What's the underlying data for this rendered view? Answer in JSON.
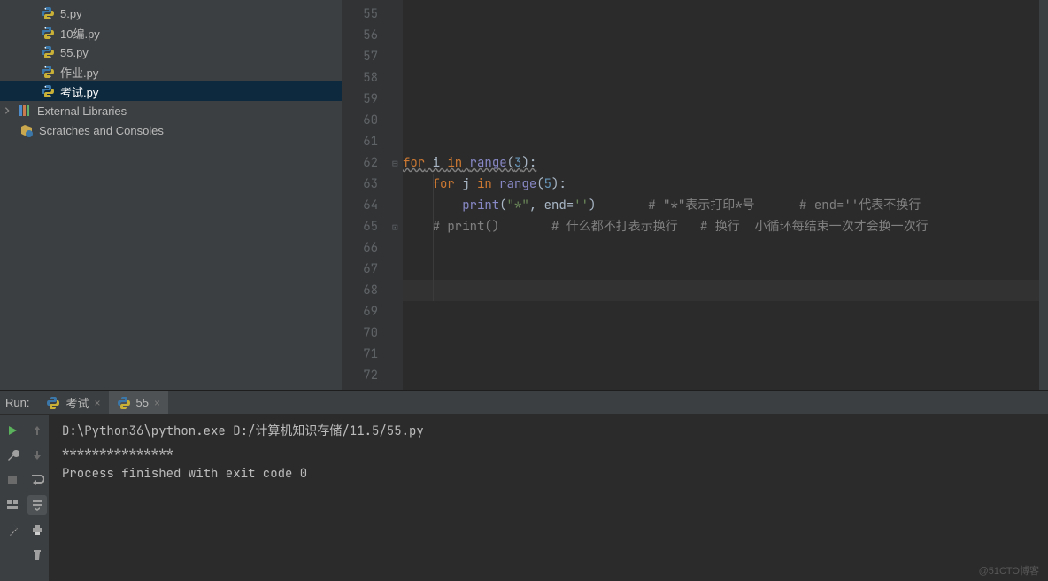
{
  "tree": {
    "files": [
      {
        "name": "5.py"
      },
      {
        "name": "10编.py"
      },
      {
        "name": "55.py"
      },
      {
        "name": "作业.py"
      },
      {
        "name": "考试.py",
        "selected": true
      }
    ],
    "external": "External Libraries",
    "scratches": "Scratches and Consoles"
  },
  "editor": {
    "first_line_no": 55,
    "last_line_no": 72,
    "current_line_no": 68,
    "lines": {
      "62": {
        "tokens": [
          {
            "cls": "kw underline-wavy",
            "t": "for"
          },
          {
            "cls": "plain underline-wavy",
            "t": " i "
          },
          {
            "cls": "kw underline-wavy",
            "t": "in"
          },
          {
            "cls": "plain underline-wavy",
            "t": " "
          },
          {
            "cls": "bi underline-wavy",
            "t": "range"
          },
          {
            "cls": "plain underline-wavy",
            "t": "("
          },
          {
            "cls": "num underline-wavy",
            "t": "3"
          },
          {
            "cls": "plain underline-wavy",
            "t": "):"
          }
        ],
        "indent": 0
      },
      "63": {
        "tokens": [
          {
            "cls": "kw",
            "t": "for"
          },
          {
            "cls": "plain",
            "t": " j "
          },
          {
            "cls": "kw",
            "t": "in"
          },
          {
            "cls": "plain",
            "t": " "
          },
          {
            "cls": "bi",
            "t": "range"
          },
          {
            "cls": "plain",
            "t": "("
          },
          {
            "cls": "num",
            "t": "5"
          },
          {
            "cls": "plain",
            "t": "):"
          }
        ],
        "indent": 1
      },
      "64": {
        "tokens": [
          {
            "cls": "fn",
            "t": "print"
          },
          {
            "cls": "plain",
            "t": "("
          },
          {
            "cls": "str",
            "t": "\"*\""
          },
          {
            "cls": "plain",
            "t": ", "
          },
          {
            "cls": "plain",
            "t": "end"
          },
          {
            "cls": "plain",
            "t": "="
          },
          {
            "cls": "str",
            "t": "''"
          },
          {
            "cls": "plain",
            "t": ")       "
          },
          {
            "cls": "cmt",
            "t": "# \"*\"表示打印*号      # end=''代表不换行"
          }
        ],
        "indent": 2
      },
      "65": {
        "tokens": [
          {
            "cls": "cmt",
            "t": "# print()       # 什么都不打表示换行   # 换行  小循环每结束一次才会换一次行"
          }
        ],
        "indent": 1
      }
    }
  },
  "run": {
    "label": "Run:",
    "tabs": [
      {
        "name": "考试",
        "active": false
      },
      {
        "name": "55",
        "active": true
      }
    ],
    "console": [
      "D:\\Python36\\python.exe D:/计算机知识存储/11.5/55.py",
      "***************",
      "Process finished with exit code 0"
    ]
  },
  "watermark": "@51CTO博客"
}
